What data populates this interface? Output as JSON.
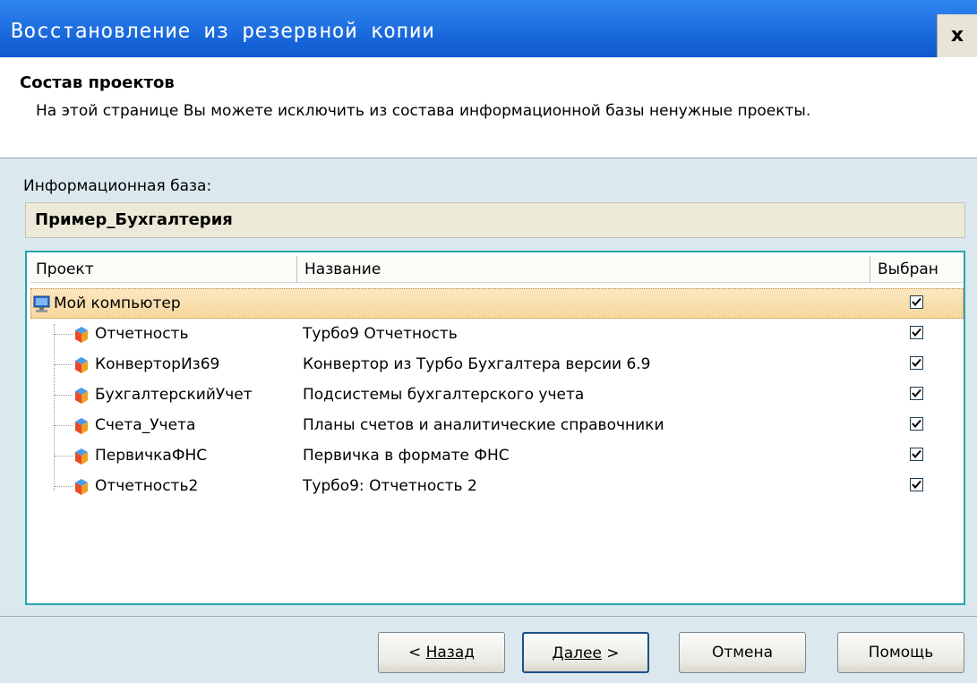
{
  "window": {
    "title": "Восстановление из резервной копии",
    "close_label": "x"
  },
  "header": {
    "title": "Состав проектов",
    "description": "На этой странице Вы можете исключить из состава информационной базы ненужные проекты."
  },
  "infobase": {
    "label": "Информационная база:",
    "value": "Пример_Бухгалтерия"
  },
  "table": {
    "columns": [
      "Проект",
      "Название",
      "Выбран"
    ],
    "root": {
      "project": "Мой компьютер",
      "selected": true,
      "icon": "computer-icon"
    },
    "rows": [
      {
        "project": "Отчетность",
        "name": "Турбо9 Отчетность",
        "selected": true,
        "icon": "project-icon"
      },
      {
        "project": "КонверторИз69",
        "name": "Конвертор из Турбо Бухгалтера версии 6.9",
        "selected": true,
        "icon": "project-icon"
      },
      {
        "project": "БухгалтерскийУчет",
        "name": "Подсистемы бухгалтерского учета",
        "selected": true,
        "icon": "project-icon"
      },
      {
        "project": "Счета_Учета",
        "name": "Планы счетов и аналитические справочники",
        "selected": true,
        "icon": "project-icon"
      },
      {
        "project": "ПервичкаФНС",
        "name": "Первичка в формате ФНС",
        "selected": true,
        "icon": "project-icon"
      },
      {
        "project": "Отчетность2",
        "name": "Турбо9: Отчетность 2",
        "selected": true,
        "icon": "project-icon"
      }
    ]
  },
  "buttons": {
    "back_prefix": "< ",
    "back_label": "Назад",
    "next_label": "Далее",
    "next_suffix": " >",
    "cancel_label": "Отмена",
    "help_label": "Помощь"
  },
  "colors": {
    "title_bar": "#1664d8",
    "dialog_bg": "#dbe9ef",
    "selection": "#f7d79c",
    "tree_border": "#27a7a8"
  }
}
